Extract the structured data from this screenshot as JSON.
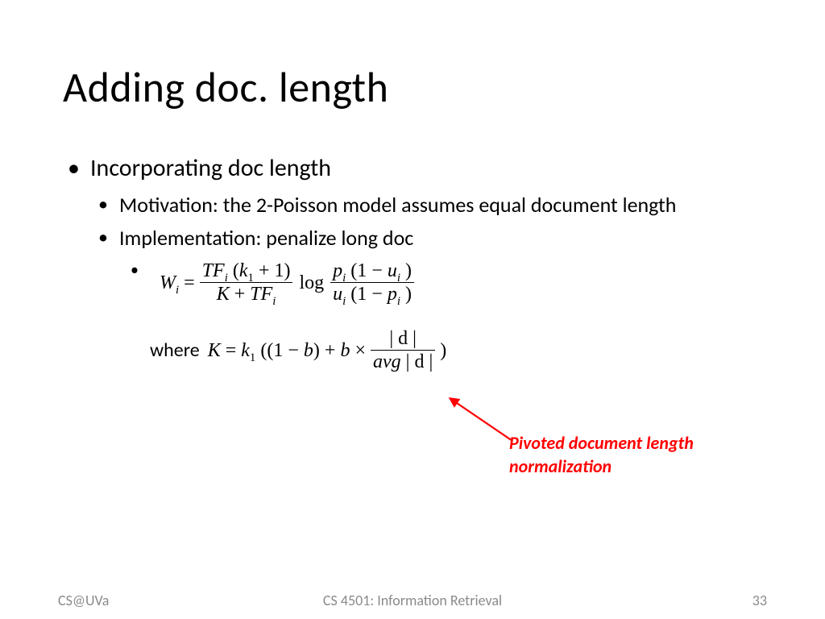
{
  "title": "Adding doc. length",
  "bullets": {
    "l1": "Incorporating doc length",
    "l2a": "Motivation: the 2-Poisson model assumes equal document length",
    "l2b": "Implementation: penalize long doc"
  },
  "eq1": {
    "W": "W",
    "i": "i",
    "eq": "=",
    "num1_tf": "TF",
    "num1_k": "k",
    "num1_one": "1",
    "num1_paren": "(",
    "num1_plus1": "+ 1)",
    "den1_K": "K",
    "den1_plus": "+",
    "den1_tf": "TF",
    "log": "log",
    "num2_p": "p",
    "num2_open": "(1 −",
    "num2_u": "u",
    "num2_close": ")",
    "den2_u": "u",
    "den2_open": "(1 −",
    "den2_p": "p",
    "den2_close": ")"
  },
  "where": "where",
  "eq2": {
    "K": "K",
    "eq": "=",
    "k": "k",
    "one": "1",
    "open": "((1 −",
    "b": "b",
    "close1": ")",
    "plus": "+",
    "times": "×",
    "num_d": "| d |",
    "den_avg": "avg",
    "den_d": "| d |",
    "close2": ")"
  },
  "annotation": "Pivoted document length normalization",
  "footer": {
    "left": "CS@UVa",
    "center": "CS 4501: Information Retrieval",
    "right": "33"
  }
}
